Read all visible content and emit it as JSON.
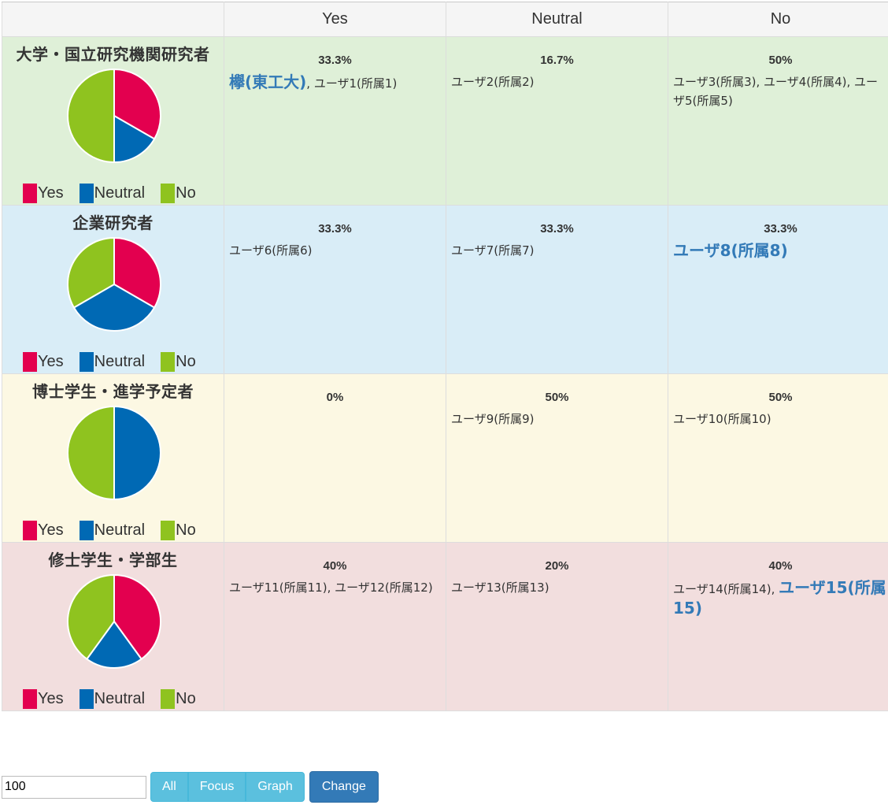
{
  "header": {
    "col1": "Yes",
    "col2": "Neutral",
    "col3": "No"
  },
  "colors": {
    "yes": "#e3004f",
    "neutral": "#0069b4",
    "no": "#8fc31f"
  },
  "legend": {
    "yes": "Yes",
    "neutral": "Neutral",
    "no": "No"
  },
  "rows": [
    {
      "category": "大学・国立研究機関研究者",
      "bg": "#dff0d8",
      "shares": {
        "yes": 33.3,
        "neutral": 16.7,
        "no": 50
      },
      "yes": {
        "pct": "33.3%",
        "highlight": "欅(東工大)",
        "text": ", ユーザ1(所属1)"
      },
      "neutral": {
        "pct": "16.7%",
        "text": "ユーザ2(所属2)"
      },
      "no": {
        "pct": "50%",
        "text": "ユーザ3(所属3), ユーザ4(所属4), ユーザ5(所属5)"
      }
    },
    {
      "category": "企業研究者",
      "bg": "#d9edf7",
      "shares": {
        "yes": 33.3,
        "neutral": 33.3,
        "no": 33.3
      },
      "yes": {
        "pct": "33.3%",
        "text": "ユーザ6(所属6)"
      },
      "neutral": {
        "pct": "33.3%",
        "text": "ユーザ7(所属7)"
      },
      "no": {
        "pct": "33.3%",
        "highlight": "ユーザ8(所属8)"
      }
    },
    {
      "category": "博士学生・進学予定者",
      "bg": "#fcf8e3",
      "shares": {
        "yes": 0,
        "neutral": 50,
        "no": 50
      },
      "yes": {
        "pct": "0%"
      },
      "neutral": {
        "pct": "50%",
        "text": "ユーザ9(所属9)"
      },
      "no": {
        "pct": "50%",
        "text": "ユーザ10(所属10)"
      }
    },
    {
      "category": "修士学生・学部生",
      "bg": "#f2dede",
      "shares": {
        "yes": 40,
        "neutral": 20,
        "no": 40
      },
      "yes": {
        "pct": "40%",
        "text": "ユーザ11(所属11), ユーザ12(所属12)"
      },
      "neutral": {
        "pct": "20%",
        "text": "ユーザ13(所属13)"
      },
      "no": {
        "pct": "40%",
        "text": "ユーザ14(所属14), ",
        "highlight": "ユーザ15(所属15)"
      }
    }
  ],
  "controls": {
    "input_value": "100",
    "buttons": [
      "All",
      "Focus",
      "Graph"
    ],
    "change_label": "Change"
  }
}
